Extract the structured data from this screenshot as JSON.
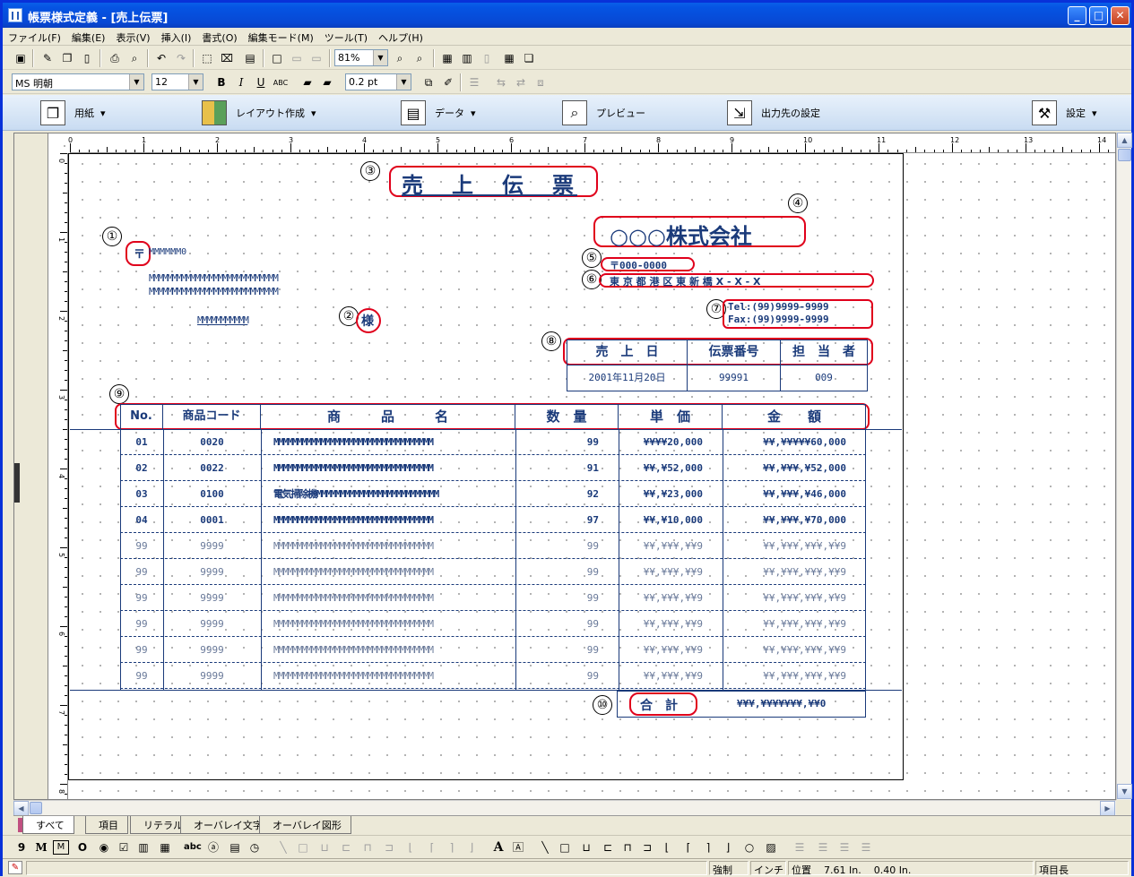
{
  "window": {
    "title": "帳票様式定義 - [売上伝票]",
    "min": "_",
    "max": "□",
    "close": "✕"
  },
  "menu": [
    "ファイル(F)",
    "編集(E)",
    "表示(V)",
    "挿入(I)",
    "書式(O)",
    "編集モード(M)",
    "ツール(T)",
    "ヘルプ(H)"
  ],
  "toolbar1": {
    "zoom": "81%"
  },
  "toolbar2": {
    "font": "MS 明朝",
    "size": "12",
    "line": "0.2 pt"
  },
  "bigbar": [
    {
      "label": "用紙",
      "dropdown": "▾"
    },
    {
      "label": "レイアウト作成",
      "dropdown": "▾"
    },
    {
      "label": "データ",
      "dropdown": "▾"
    },
    {
      "label": "プレビュー",
      "dropdown": ""
    },
    {
      "label": "出力先の設定",
      "dropdown": ""
    },
    {
      "label": "設定",
      "dropdown": "▾"
    }
  ],
  "ruler_h": [
    "0",
    "1",
    "2",
    "3",
    "4",
    "5",
    "6",
    "7",
    "8",
    "9",
    "10",
    "11",
    "12",
    "13",
    "14"
  ],
  "ruler_v": [
    "0",
    "1",
    "2",
    "3",
    "4",
    "5",
    "6",
    "7",
    "8"
  ],
  "callouts": [
    "①",
    "②",
    "③",
    "④",
    "⑤",
    "⑥",
    "⑦",
    "⑧",
    "⑨",
    "⑩"
  ],
  "form": {
    "title": "売　上　伝　票",
    "company": "○○○株式会社",
    "postal": "〒000-0000",
    "address": "東 京 都 港 区 東 新 橋 X - X - X",
    "tel": "Tel:(99)9999-9999",
    "fax": "Fax:(99)9999-9999",
    "cust_postal_mark": "〒",
    "cust_postal": "MMMMMM0",
    "cust_addr1": "MMMMMMMMMMMMMMMMMMMMMMMMMMMM",
    "cust_addr2": "MMMMMMMMMMMMMMMMMMMMMMMMMMMM",
    "cust_name": "MMMMMMMMMMM",
    "honorific": "様",
    "info_headers": [
      "売　上　日",
      "伝票番号",
      "担　当　者"
    ],
    "info_values": [
      "2001年11月20日",
      "99991",
      "009"
    ],
    "table_headers": [
      "No.",
      "商品コード",
      "商　　　品　　　名",
      "数　量",
      "単　価",
      "金　　額"
    ],
    "rows": [
      [
        "01",
        "0020",
        "MMMMMMMMMMMMMMMMMMMMMMMMMMMMMMMMMM",
        "99",
        "¥¥¥¥20,000",
        "¥¥,¥¥¥¥¥60,000"
      ],
      [
        "02",
        "0022",
        "MMMMMMMMMMMMMMMMMMMMMMMMMMMMMMMMMM",
        "91",
        "¥¥,¥52,000",
        "¥¥,¥¥¥,¥52,000"
      ],
      [
        "03",
        "0100",
        "電気掃除機MMMMMMMMMMMMMMMMMMMMMMMMMM",
        "92",
        "¥¥,¥23,000",
        "¥¥,¥¥¥,¥46,000"
      ],
      [
        "04",
        "0001",
        "MMMMMMMMMMMMMMMMMMMMMMMMMMMMMMMMMM",
        "97",
        "¥¥,¥10,000",
        "¥¥,¥¥¥,¥70,000"
      ],
      [
        "99",
        "9999",
        "MMMMMMMMMMMMMMMMMMMMMMMMMMMMMMMMMM",
        "99",
        "¥¥,¥¥¥,¥¥9",
        "¥¥,¥¥¥,¥¥¥,¥¥9"
      ],
      [
        "99",
        "9999",
        "MMMMMMMMMMMMMMMMMMMMMMMMMMMMMMMMMM",
        "99",
        "¥¥,¥¥¥,¥¥9",
        "¥¥,¥¥¥,¥¥¥,¥¥9"
      ],
      [
        "99",
        "9999",
        "MMMMMMMMMMMMMMMMMMMMMMMMMMMMMMMMMM",
        "99",
        "¥¥,¥¥¥,¥¥9",
        "¥¥,¥¥¥,¥¥¥,¥¥9"
      ],
      [
        "99",
        "9999",
        "MMMMMMMMMMMMMMMMMMMMMMMMMMMMMMMMMM",
        "99",
        "¥¥,¥¥¥,¥¥9",
        "¥¥,¥¥¥,¥¥¥,¥¥9"
      ],
      [
        "99",
        "9999",
        "MMMMMMMMMMMMMMMMMMMMMMMMMMMMMMMMMM",
        "99",
        "¥¥,¥¥¥,¥¥9",
        "¥¥,¥¥¥,¥¥¥,¥¥9"
      ],
      [
        "99",
        "9999",
        "MMMMMMMMMMMMMMMMMMMMMMMMMMMMMMMMMM",
        "99",
        "¥¥,¥¥¥,¥¥9",
        "¥¥,¥¥¥,¥¥¥,¥¥9"
      ]
    ],
    "total_label": "合　計",
    "total_value": "¥¥¥,¥¥¥¥¥¥¥,¥¥0"
  },
  "tabs": [
    "すべて",
    "項目",
    "リテラル",
    "オーバレイ文字",
    "オーバレイ図形"
  ],
  "drawtools": [
    "9",
    "M",
    "M",
    "O",
    "◉",
    "☑",
    "▥",
    "▦",
    "abc",
    "ⓐ",
    "▤",
    "◷"
  ],
  "status": {
    "mode": "強制",
    "unit": "インチ",
    "pos_label": "位置",
    "x": "7.61 In.",
    "y": "0.40 In.",
    "item": "項目長"
  }
}
